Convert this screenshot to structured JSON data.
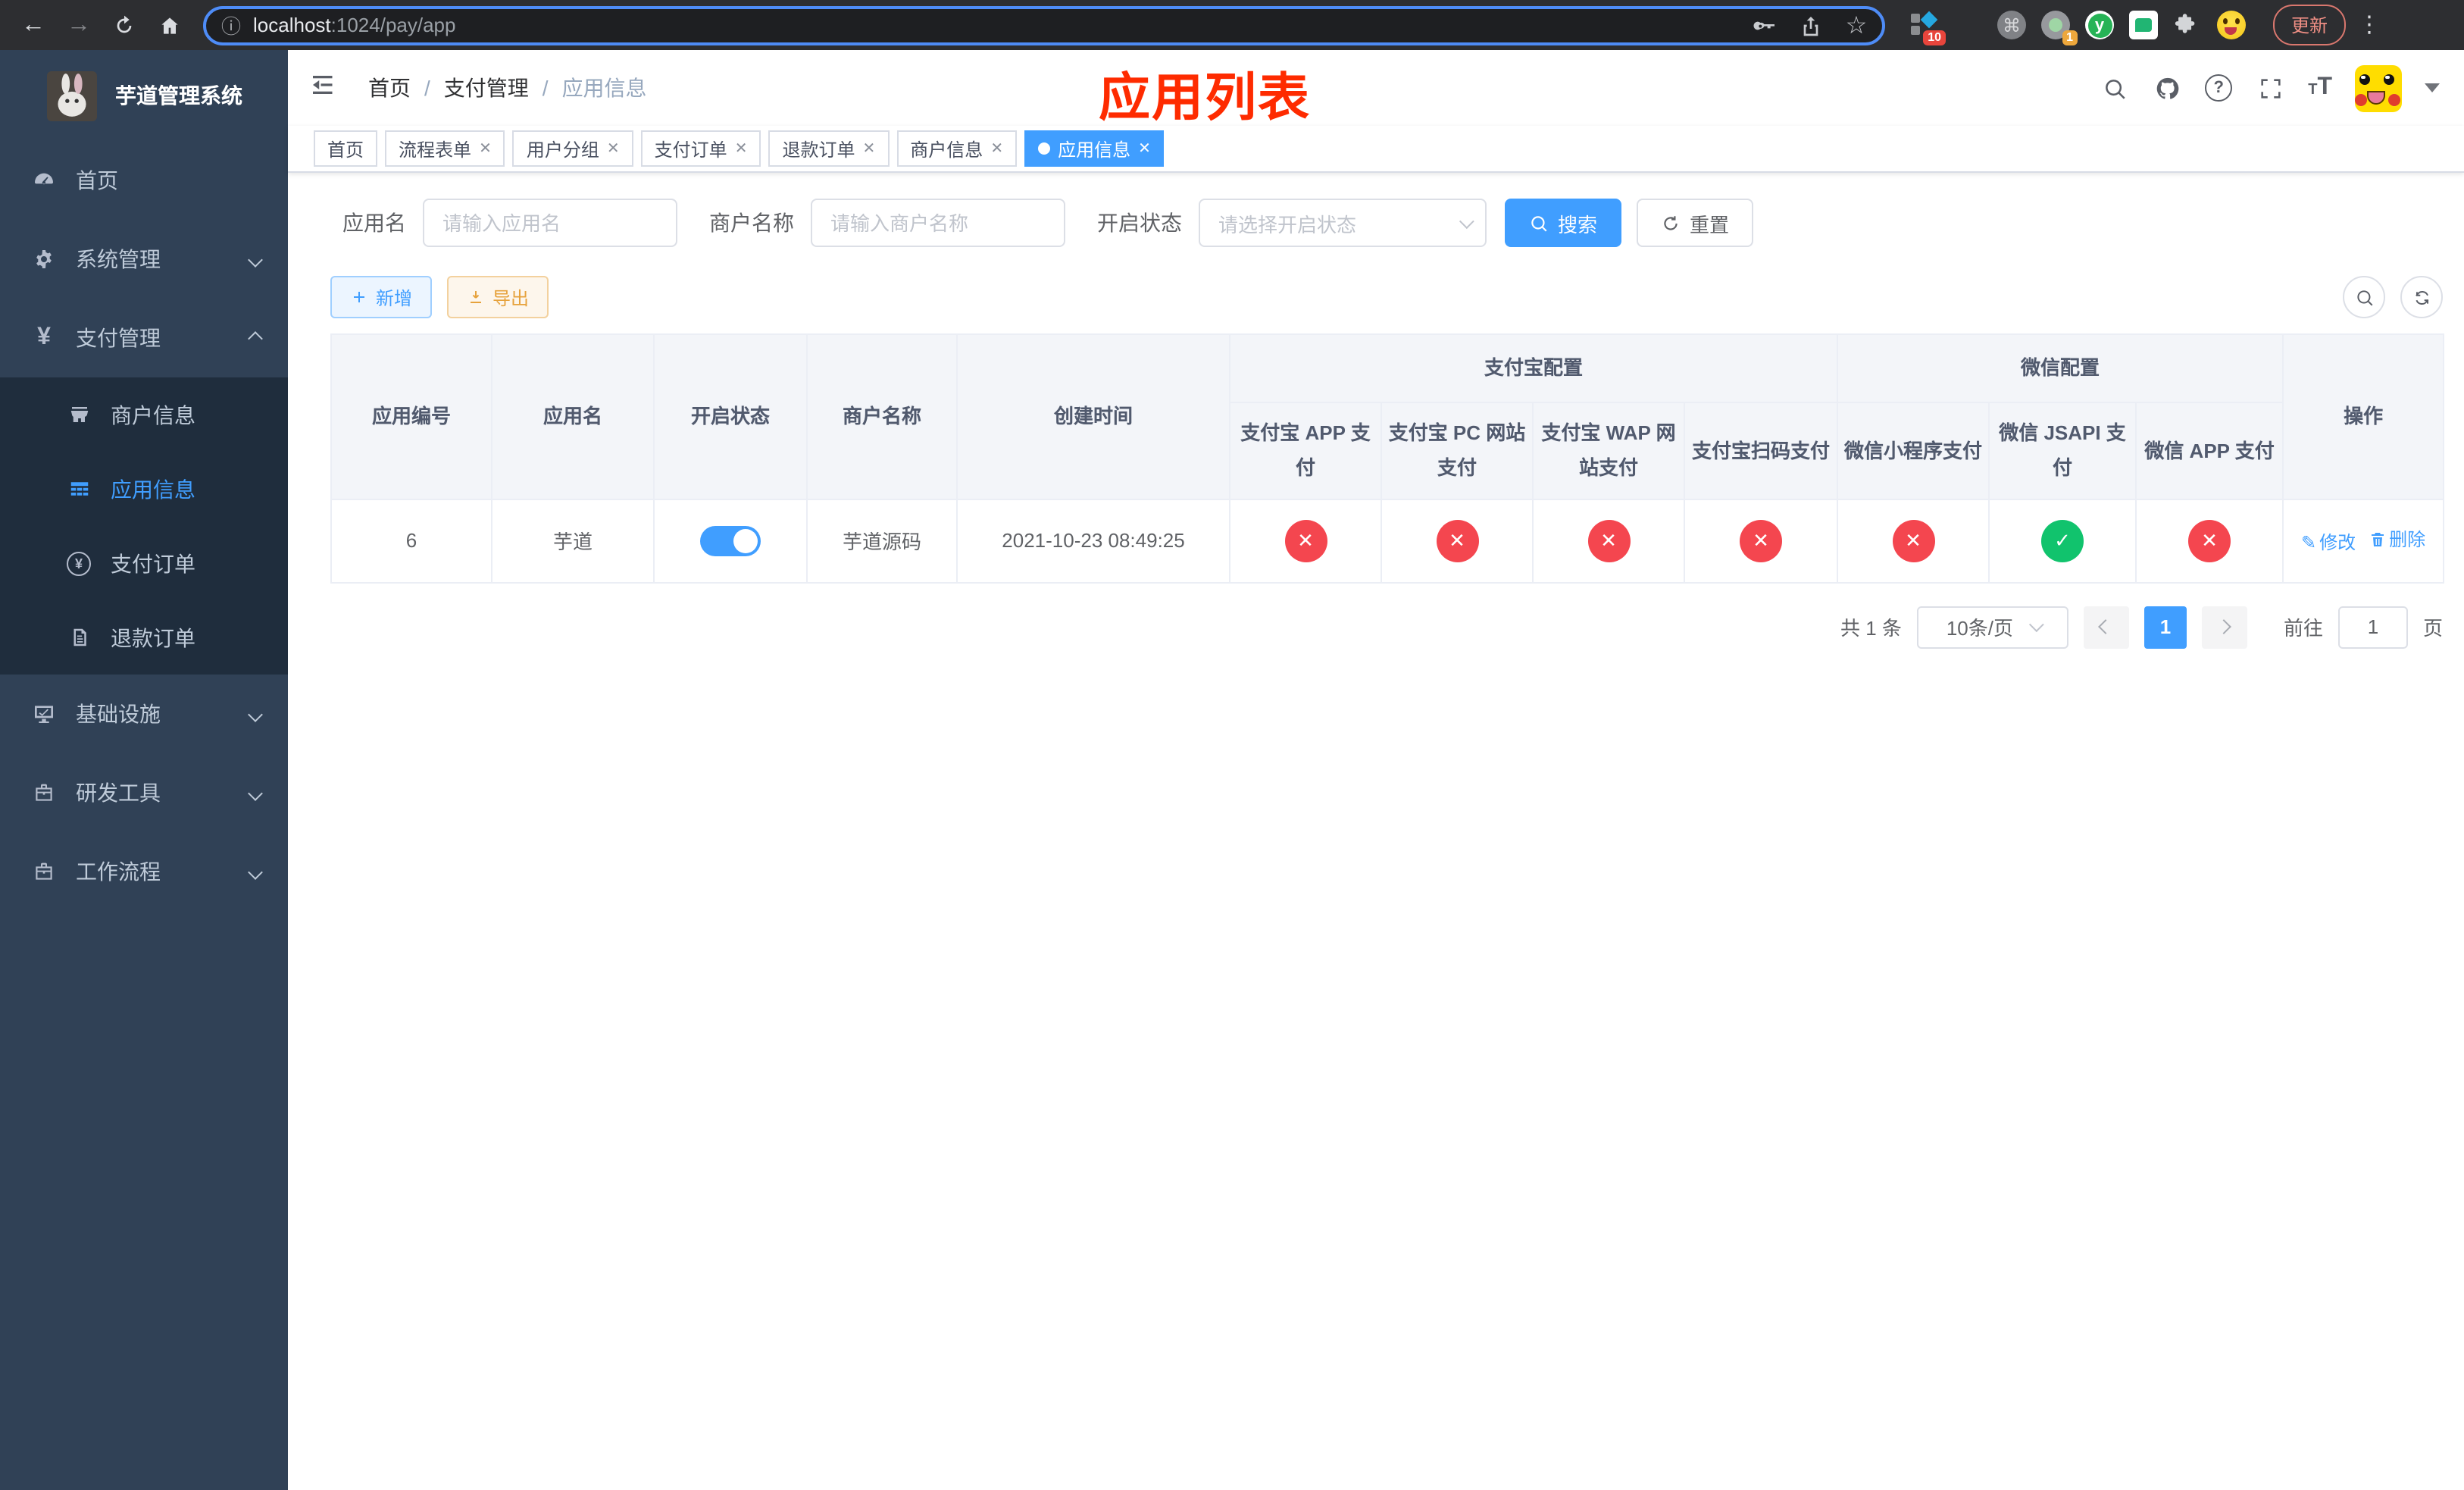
{
  "browser": {
    "url_host": "localhost",
    "url_rest": ":1024/pay/app",
    "ext_badge_10": "10",
    "ext_badge_1": "1",
    "update_label": "更新"
  },
  "sidebar": {
    "title": "芋道管理系统",
    "menu": [
      {
        "label": "首页"
      },
      {
        "label": "系统管理"
      },
      {
        "label": "支付管理"
      },
      {
        "label": "商户信息"
      },
      {
        "label": "应用信息"
      },
      {
        "label": "支付订单"
      },
      {
        "label": "退款订单"
      },
      {
        "label": "基础设施"
      },
      {
        "label": "研发工具"
      },
      {
        "label": "工作流程"
      }
    ]
  },
  "header": {
    "breadcrumb": [
      "首页",
      "支付管理",
      "应用信息"
    ],
    "page_title": "应用列表"
  },
  "tabs": [
    {
      "label": "首页"
    },
    {
      "label": "流程表单"
    },
    {
      "label": "用户分组"
    },
    {
      "label": "支付订单"
    },
    {
      "label": "退款订单"
    },
    {
      "label": "商户信息"
    },
    {
      "label": "应用信息"
    }
  ],
  "filters": {
    "app_name_label": "应用名",
    "app_name_placeholder": "请输入应用名",
    "merchant_label": "商户名称",
    "merchant_placeholder": "请输入商户名称",
    "status_label": "开启状态",
    "status_placeholder": "请选择开启状态",
    "search_label": "搜索",
    "reset_label": "重置"
  },
  "toolbar": {
    "add_label": "新增",
    "export_label": "导出"
  },
  "table": {
    "col_app_id": "应用编号",
    "col_app_name": "应用名",
    "col_status": "开启状态",
    "col_merchant": "商户名称",
    "col_created": "创建时间",
    "group_alipay": "支付宝配置",
    "group_wechat": "微信配置",
    "col_actions": "操作",
    "sub_columns": [
      "支付宝 APP 支付",
      "支付宝 PC 网站支付",
      "支付宝 WAP 网站支付",
      "支付宝扫码支付",
      "微信小程序支付",
      "微信 JSAPI 支付",
      "微信 APP 支付"
    ],
    "row": {
      "app_id": "6",
      "app_name": "芋道",
      "enabled": true,
      "merchant": "芋道源码",
      "created_at": "2021-10-23 08:49:25",
      "channel_enabled": [
        false,
        false,
        false,
        false,
        false,
        true,
        false
      ],
      "edit_label": "修改",
      "delete_label": "删除"
    }
  },
  "pagination": {
    "total_label": "共 1 条",
    "page_size_label": "10条/页",
    "current_page": "1",
    "goto_label": "前往",
    "goto_value": "1",
    "page_unit": "页"
  },
  "icons": {
    "status_yes": "✓",
    "status_no": "✕",
    "colors": {
      "accent": "#409eff",
      "success": "#11c36d",
      "danger": "#f4464f",
      "warning": "#e6a23c",
      "sidebar_bg": "#304156",
      "submenu_bg": "#1f2d3d",
      "annotation_red": "#fe2b00"
    }
  }
}
